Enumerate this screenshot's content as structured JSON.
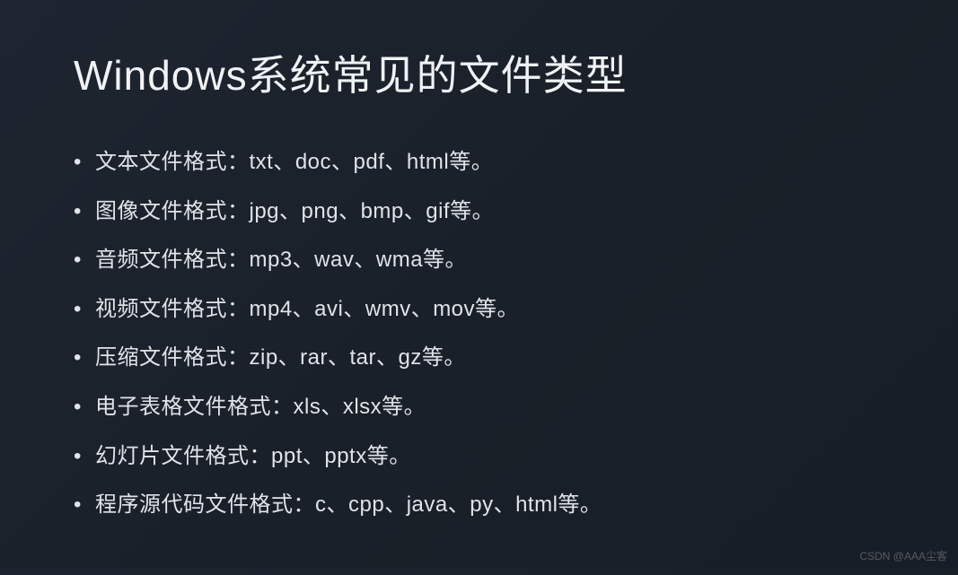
{
  "slide": {
    "title": "Windows系统常见的文件类型",
    "bullets": [
      "文本文件格式：txt、doc、pdf、html等。",
      "图像文件格式：jpg、png、bmp、gif等。",
      "音频文件格式：mp3、wav、wma等。",
      " 视频文件格式：mp4、avi、wmv、mov等。",
      "压缩文件格式：zip、rar、tar、gz等。",
      "电子表格文件格式：xls、xlsx等。",
      "幻灯片文件格式：ppt、pptx等。",
      "程序源代码文件格式：c、cpp、java、py、html等。"
    ]
  },
  "watermark": "CSDN @AAA尘客"
}
